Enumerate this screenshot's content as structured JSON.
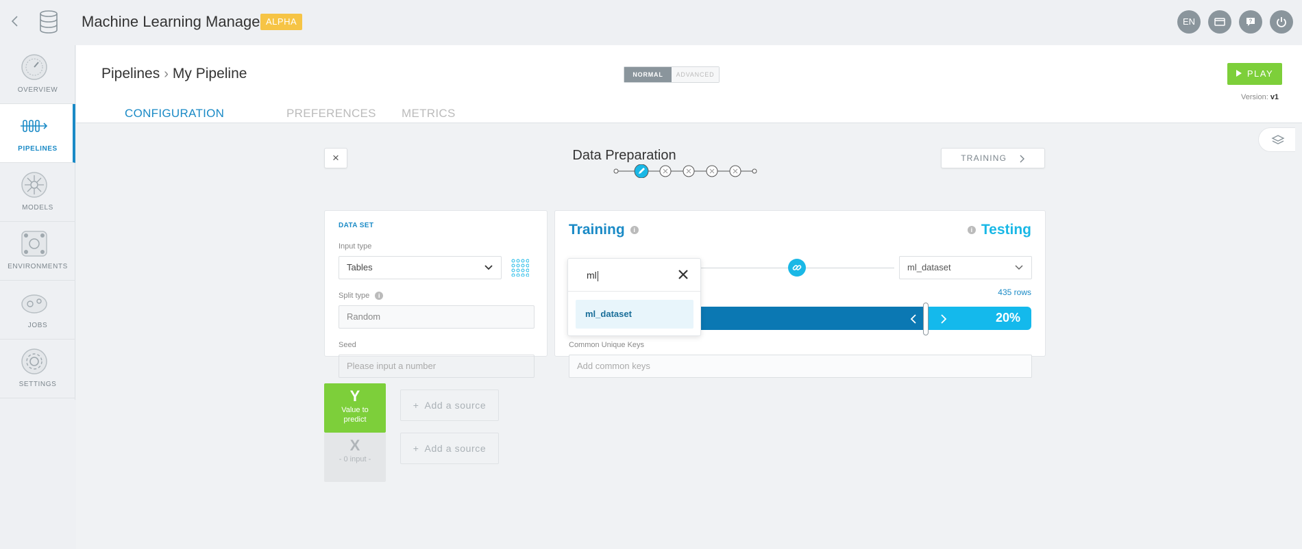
{
  "header": {
    "app_title": "Machine Learning Manager",
    "badge": "ALPHA",
    "language": "EN"
  },
  "sidebar": {
    "items": [
      {
        "label": "OVERVIEW",
        "icon": "gauge-icon"
      },
      {
        "label": "PIPELINES",
        "icon": "pipeline-icon",
        "active": true
      },
      {
        "label": "MODELS",
        "icon": "brain-icon"
      },
      {
        "label": "ENVIRONMENTS",
        "icon": "network-icon"
      },
      {
        "label": "JOBS",
        "icon": "jobs-icon"
      },
      {
        "label": "SETTINGS",
        "icon": "gear-icon"
      }
    ]
  },
  "page": {
    "breadcrumb_root": "Pipelines",
    "breadcrumb_current": "My Pipeline",
    "mode_normal": "NORMAL",
    "mode_advanced": "ADVANCED",
    "play_label": "PLAY",
    "version_label": "Version:",
    "version_value": "v1",
    "tabs": [
      "CONFIGURATION",
      "PREFERENCES",
      "METRICS"
    ]
  },
  "step": {
    "title": "Data Preparation",
    "next_label": "TRAINING",
    "close": "×"
  },
  "dataset": {
    "title": "DATA SET",
    "input_type_label": "Input type",
    "input_type_value": "Tables",
    "split_type_label": "Split type",
    "split_type_value": "Random",
    "seed_label": "Seed",
    "seed_placeholder": "Please input a number"
  },
  "split": {
    "training_label": "Training",
    "testing_label": "Testing",
    "testing_dataset": "ml_dataset",
    "rows": "435 rows",
    "test_percent": "20%",
    "test_fraction": 0.2,
    "keys_label": "Common Unique Keys",
    "keys_placeholder": "Add common keys"
  },
  "dropdown": {
    "search_value": "ml",
    "option": "ml_dataset"
  },
  "sources": {
    "y_letter": "Y",
    "y_text": "Value to predict",
    "x_letter": "X",
    "x_text": "- 0 input -",
    "add_label": "Add a source"
  },
  "colors": {
    "accent": "#1a8ac6",
    "testing": "#1ab8e6",
    "play": "#7dcf3a",
    "badge": "#f6c445"
  }
}
